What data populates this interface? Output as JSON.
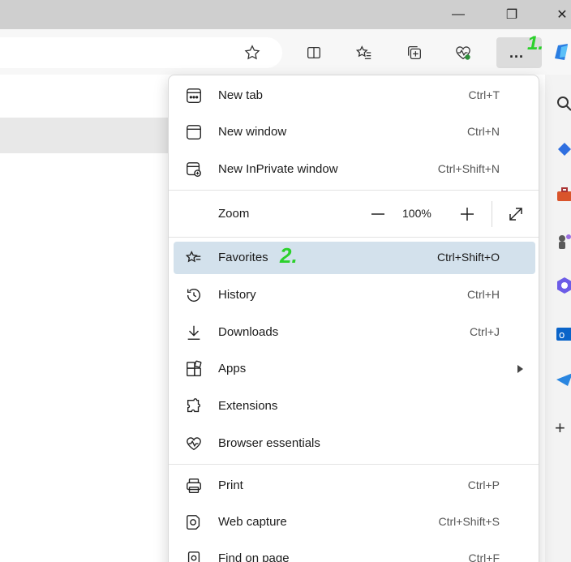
{
  "window": {
    "minimize_glyph": "—",
    "restore_glyph": "❐",
    "close_glyph": "✕"
  },
  "toolbar": {
    "more_label": "...",
    "annotation_1": "1.",
    "icons": [
      "star-icon",
      "split-screen-icon",
      "favorites-icon",
      "collections-icon",
      "browser-essentials-icon"
    ]
  },
  "menu": {
    "annotation_2": "2.",
    "items": [
      {
        "label": "New tab",
        "shortcut": "Ctrl+T",
        "icon": "new-tab-icon"
      },
      {
        "label": "New window",
        "shortcut": "Ctrl+N",
        "icon": "new-window-icon"
      },
      {
        "label": "New InPrivate window",
        "shortcut": "Ctrl+Shift+N",
        "icon": "inprivate-icon"
      },
      {
        "label": "Zoom",
        "zoom_value": "100%",
        "minus": "—",
        "plus": "+"
      },
      {
        "label": "Favorites",
        "shortcut": "Ctrl+Shift+O",
        "icon": "favorites-icon",
        "active": true
      },
      {
        "label": "History",
        "shortcut": "Ctrl+H",
        "icon": "history-icon"
      },
      {
        "label": "Downloads",
        "shortcut": "Ctrl+J",
        "icon": "download-icon"
      },
      {
        "label": "Apps",
        "shortcut": "",
        "icon": "apps-icon"
      },
      {
        "label": "Extensions",
        "shortcut": "",
        "icon": "extensions-icon"
      },
      {
        "label": "Browser essentials",
        "shortcut": "",
        "icon": "heart-pulse-icon"
      },
      {
        "label": "Print",
        "shortcut": "Ctrl+P",
        "icon": "print-icon"
      },
      {
        "label": "Web capture",
        "shortcut": "Ctrl+Shift+S",
        "icon": "web-capture-icon"
      },
      {
        "label": "Find on page",
        "shortcut": "Ctrl+F",
        "icon": "find-icon"
      }
    ]
  },
  "sidebar": {
    "plus_label": "+"
  },
  "colors": {
    "active_item": "#d3e1ec",
    "annotation": "#2bd12b",
    "titlebar": "#cfcfcf"
  }
}
